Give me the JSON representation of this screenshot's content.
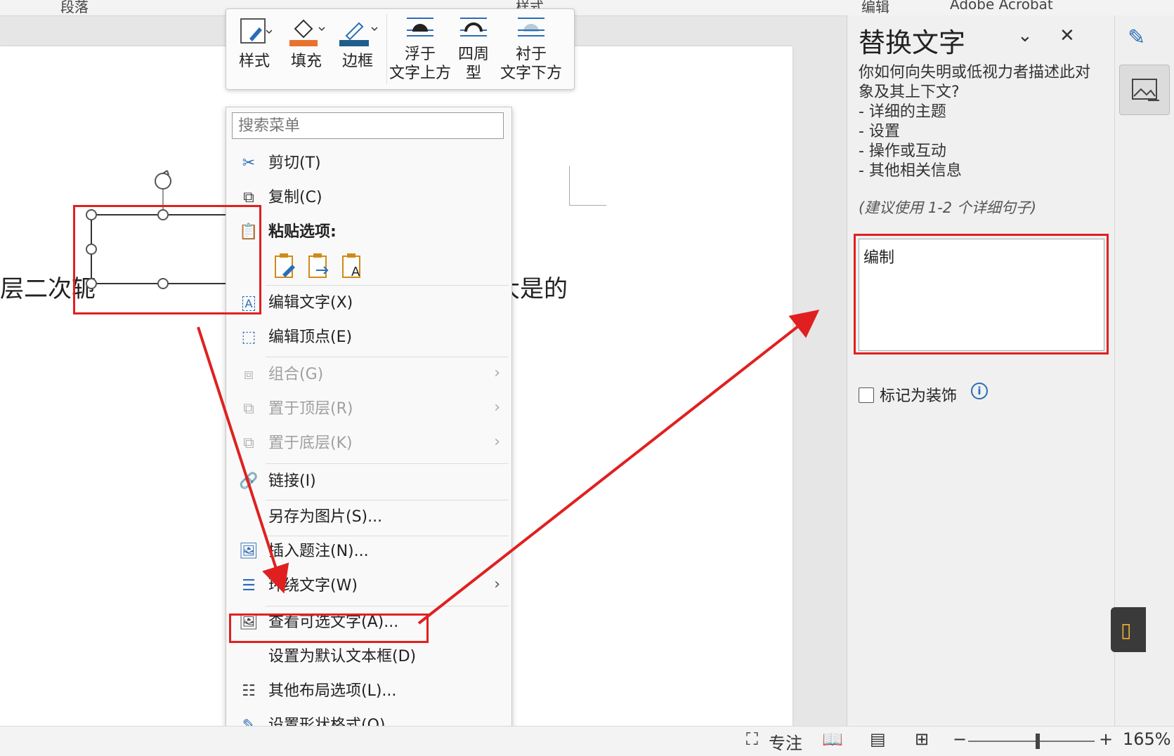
{
  "ribbon": {
    "groups": [
      "段落",
      "样式",
      "编辑",
      "Adobe Acrobat"
    ]
  },
  "document": {
    "text_left": "层二次轭",
    "text_right": "大是的"
  },
  "mini_toolbar": {
    "style_label": "样式",
    "fill_label": "填充",
    "border_label": "边框",
    "wrap_front_line1": "浮于",
    "wrap_front_line2": "文字上方",
    "wrap_square_line1": "四周",
    "wrap_square_line2": "型",
    "wrap_behind_line1": "衬于",
    "wrap_behind_line2": "文字下方",
    "fill_color": "#e9722e",
    "border_color": "#1f5d8c"
  },
  "context_menu": {
    "search_placeholder": "搜索菜单",
    "items": {
      "cut": "剪切(T)",
      "copy": "复制(C)",
      "paste_options": "粘贴选项:",
      "edit_text": "编辑文字(X)",
      "edit_points": "编辑顶点(E)",
      "group": "组合(G)",
      "bring_front": "置于顶层(R)",
      "send_back": "置于底层(K)",
      "link": "链接(I)",
      "save_as_picture": "另存为图片(S)...",
      "insert_caption": "插入题注(N)...",
      "wrap_text": "环绕文字(W)",
      "view_alt_text": "查看可选文字(A)...",
      "set_default_textbox": "设置为默认文本框(D)",
      "more_layout": "其他布局选项(L)...",
      "format_shape": "设置形状格式(O)..."
    }
  },
  "alt_text_pane": {
    "title": "替换文字",
    "description": "你如何向失明或低视力者描述此对象及其上下文?",
    "bullets": [
      "- 详细的主题",
      "- 设置",
      "- 操作或互动",
      "- 其他相关信息"
    ],
    "hint": "(建议使用 1-2 个详细句子)",
    "alt_text_value": "编制",
    "decorative_label": "标记为装饰",
    "decorative_checked": false
  },
  "status_bar": {
    "focus_label": "专注",
    "zoom": "165%",
    "zoom_minus": "−",
    "zoom_plus": "+"
  },
  "annotation_color": "#e02020",
  "accent_color": "#2a6db5"
}
